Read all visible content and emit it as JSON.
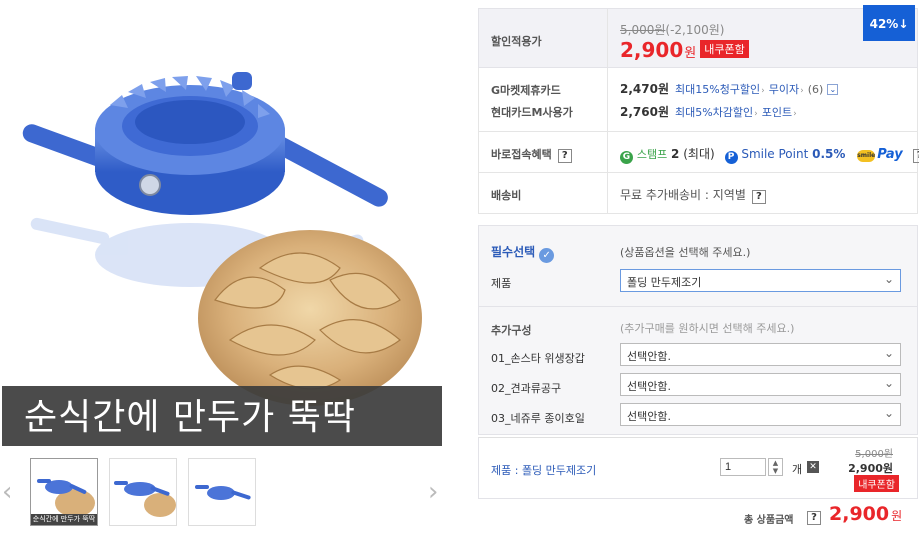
{
  "product": {
    "caption": "순식간에 만두가 뚝딱",
    "thumb_caption": "순식간에 만두가 뚝딱"
  },
  "price": {
    "label": "할인적용가",
    "original": "5,000",
    "original_unit": "원",
    "discount_amount": "(-2,100원)",
    "sale": "2,900",
    "sale_unit": "원",
    "coupon_badge": "내쿠폰함",
    "discount_rate": "42%↓"
  },
  "cards": [
    {
      "label": "G마켓제휴카드",
      "price": "2,470원",
      "desc": "최대15%청구할인",
      "extra": "무이자",
      "extra_count": "(6)"
    },
    {
      "label": "현대카드M사용가",
      "price": "2,760원",
      "desc": "최대5%차감할인",
      "extra": "포인트"
    }
  ],
  "benefit": {
    "label": "바로접속혜택",
    "stamp_label": "스탬프",
    "stamp_count": "2",
    "stamp_note": "(최대)",
    "smile_point_label": "Smile Point",
    "smile_point_rate": "0.5%",
    "smile_pay": "Pay",
    "smile_pay_coin": "smile"
  },
  "shipping": {
    "label": "배송비",
    "text": "무료 추가배송비 : 지역별"
  },
  "options": {
    "required_title": "필수선택",
    "required_hint": "(상품옵션을 선택해 주세요.)",
    "required_label": "제품",
    "required_value": "폴딩 만두제조기",
    "additional_title": "추가구성",
    "additional_hint": "(추가구매를 원하시면 선택해 주세요.)",
    "additional": [
      {
        "label": "01_손스타 위생장갑",
        "value": "선택안함."
      },
      {
        "label": "02_견과류공구",
        "value": "선택안함."
      },
      {
        "label": "03_네쥬루 종이호일",
        "value": "선택안함."
      }
    ]
  },
  "selected": {
    "name": "제품 : 폴딩 만두제조기",
    "quantity": "1",
    "unit": "개",
    "original": "5,000원",
    "price": "2,900원",
    "coupon": "내쿠폰함"
  },
  "total": {
    "label": "총 상품금액",
    "amount": "2,900",
    "unit": "원"
  },
  "icons": {
    "prev": "chevron-left-icon",
    "next": "chevron-right-icon",
    "chevron": "chevron-down-icon"
  },
  "colors": {
    "accent_red": "#e9262a",
    "accent_blue": "#1560d6",
    "link_blue": "#2c5bb8",
    "stamp_green": "#3aa34a"
  }
}
